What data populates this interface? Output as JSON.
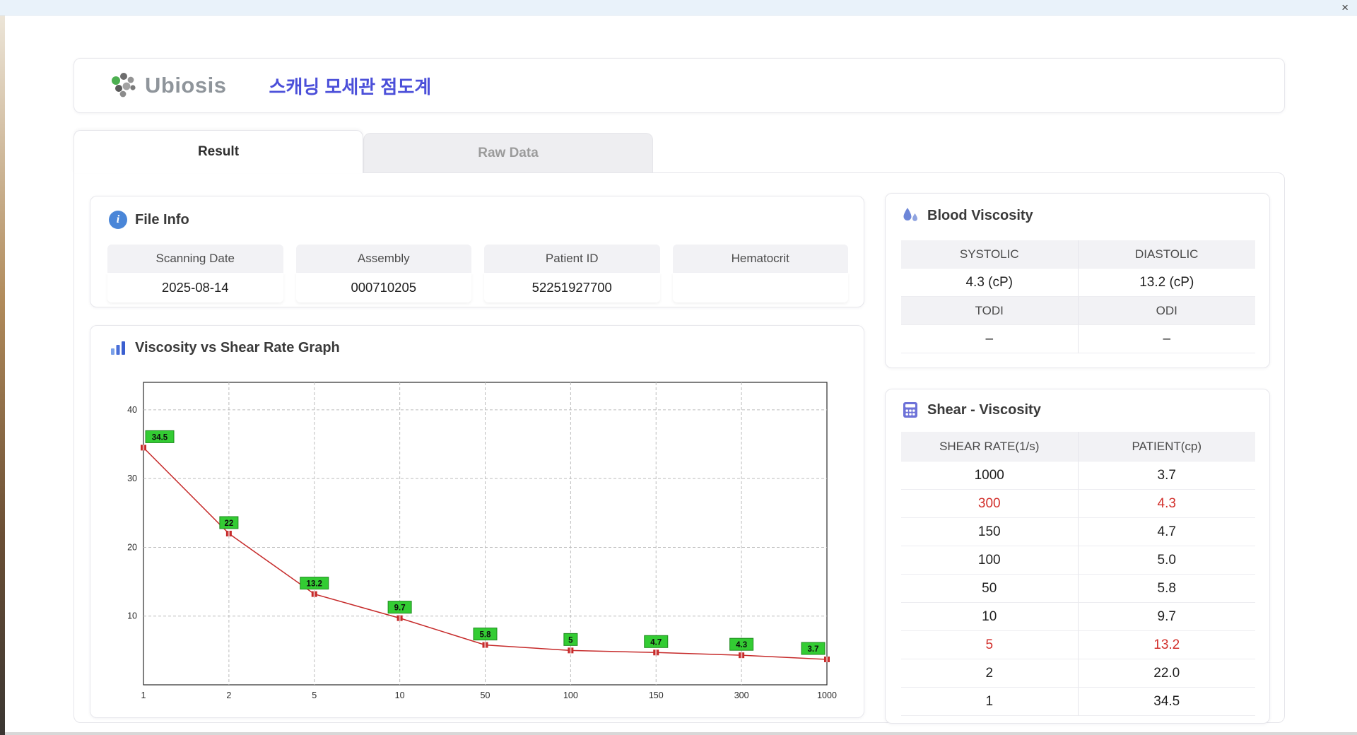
{
  "window": {
    "close_icon": "×"
  },
  "header": {
    "logo_text": "Ubiosis",
    "title": "스캐닝 모세관 점도계"
  },
  "tabs": [
    {
      "label": "Result",
      "active": true
    },
    {
      "label": "Raw Data",
      "active": false
    }
  ],
  "file_info": {
    "title": "File Info",
    "fields": [
      {
        "label": "Scanning Date",
        "value": "2025-08-14"
      },
      {
        "label": "Assembly",
        "value": "000710205"
      },
      {
        "label": "Patient ID",
        "value": "52251927700"
      },
      {
        "label": "Hematocrit",
        "value": ""
      }
    ]
  },
  "blood_viscosity": {
    "title": "Blood Viscosity",
    "rows": [
      {
        "headers": [
          "SYSTOLIC",
          "DIASTOLIC"
        ],
        "values": [
          "4.3 (cP)",
          "13.2 (cP)"
        ]
      },
      {
        "headers": [
          "TODI",
          "ODI"
        ],
        "values": [
          "–",
          "–"
        ]
      }
    ]
  },
  "graph_section": {
    "title": "Viscosity vs Shear Rate Graph"
  },
  "chart_data": {
    "type": "line",
    "title": "Viscosity vs Shear Rate Graph",
    "x_labels": [
      "1",
      "2",
      "5",
      "10",
      "50",
      "100",
      "150",
      "300",
      "1000"
    ],
    "x_axis_layout": "ticks evenly spaced (shear-rate steps)",
    "values": [
      34.5,
      22,
      13.2,
      9.7,
      5.8,
      5,
      4.7,
      4.3,
      3.7
    ],
    "point_labels": [
      "34.5",
      "22",
      "13.2",
      "9.7",
      "5.8",
      "5",
      "4.7",
      "4.3",
      "3.7"
    ],
    "y_ticks": [
      10,
      20,
      30,
      40
    ],
    "ylim": [
      0,
      44
    ],
    "grid": "dashed",
    "legend": "none",
    "line_color": "#c62a2a",
    "marker_color": "#c62a2a",
    "point_label_bg": "#33cc33",
    "point_label_border": "#1d8a1d"
  },
  "shear_table": {
    "title": "Shear - Viscosity",
    "columns": [
      "SHEAR RATE(1/s)",
      "PATIENT(cp)"
    ],
    "rows": [
      {
        "shear": "1000",
        "patient": "3.7",
        "highlight": false
      },
      {
        "shear": "300",
        "patient": "4.3",
        "highlight": true
      },
      {
        "shear": "150",
        "patient": "4.7",
        "highlight": false
      },
      {
        "shear": "100",
        "patient": "5.0",
        "highlight": false
      },
      {
        "shear": "50",
        "patient": "5.8",
        "highlight": false
      },
      {
        "shear": "10",
        "patient": "9.7",
        "highlight": false
      },
      {
        "shear": "5",
        "patient": "13.2",
        "highlight": true
      },
      {
        "shear": "2",
        "patient": "22.0",
        "highlight": false
      },
      {
        "shear": "1",
        "patient": "34.5",
        "highlight": false
      }
    ]
  },
  "colors": {
    "accent_blue": "#4b4fd9",
    "highlight_red": "#d2302c",
    "icon_blue": "#4a86d8",
    "chart_line_red": "#c62a2a",
    "chart_label_green": "#33cc33"
  }
}
